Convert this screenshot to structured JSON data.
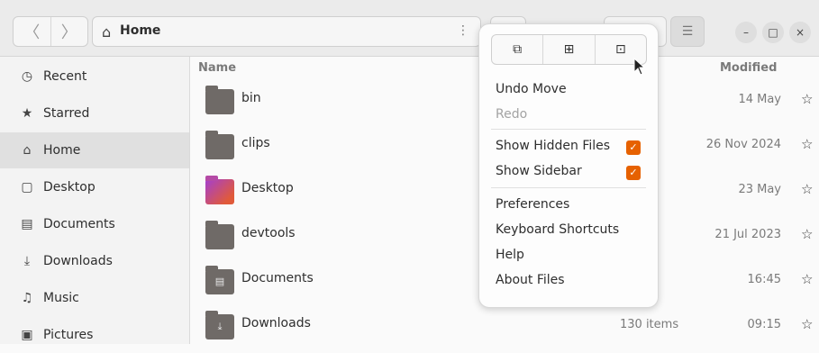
{
  "header": {
    "nav_back": "〈",
    "nav_forward": "〉",
    "path": {
      "home_icon": "⌂",
      "crumb": "Home",
      "menu_dots": "⋮"
    },
    "view_button": "⊞",
    "hamburger": "☰",
    "window_controls": {
      "minimize": "–",
      "maximize": "□",
      "close": "×"
    }
  },
  "sidebar": {
    "items": [
      {
        "icon": "clock-icon",
        "glyph": "◷",
        "label": "Recent"
      },
      {
        "icon": "star-icon",
        "glyph": "★",
        "label": "Starred"
      },
      {
        "icon": "home-icon",
        "glyph": "⌂",
        "label": "Home"
      },
      {
        "icon": "desktop-icon",
        "glyph": "▢",
        "label": "Desktop"
      },
      {
        "icon": "document-icon",
        "glyph": "▤",
        "label": "Documents"
      },
      {
        "icon": "download-icon",
        "glyph": "⤓",
        "label": "Downloads"
      },
      {
        "icon": "music-icon",
        "glyph": "♫",
        "label": "Music"
      },
      {
        "icon": "pictures-icon",
        "glyph": "▣",
        "label": "Pictures"
      }
    ]
  },
  "columns": {
    "name": "Name",
    "modified": "Modified"
  },
  "files": [
    {
      "name": "bin",
      "size": "ms",
      "modified": "14 May",
      "star": "☆"
    },
    {
      "name": "clips",
      "size": "ms",
      "modified": "26 Nov 2024",
      "star": "☆"
    },
    {
      "name": "Desktop",
      "size": "n",
      "modified": "23 May",
      "star": "☆"
    },
    {
      "name": "devtools",
      "size": "ms",
      "modified": "21 Jul 2023",
      "star": "☆"
    },
    {
      "name": "Documents",
      "size": "ems",
      "modified": "16:45",
      "star": "☆"
    },
    {
      "name": "Downloads",
      "size": "130 items",
      "modified": "09:15",
      "star": "☆"
    }
  ],
  "menu": {
    "tabs": [
      "⧉",
      "⊞",
      "⊡"
    ],
    "items": {
      "undo": "Undo Move",
      "redo": "Redo",
      "show_hidden": "Show Hidden Files",
      "show_sidebar": "Show Sidebar",
      "preferences": "Preferences",
      "shortcuts": "Keyboard Shortcuts",
      "help": "Help",
      "about": "About Files"
    },
    "check_glyph": "✓"
  },
  "colors": {
    "accent": "#e66100",
    "sidebar_active": "#e0e0e0"
  }
}
